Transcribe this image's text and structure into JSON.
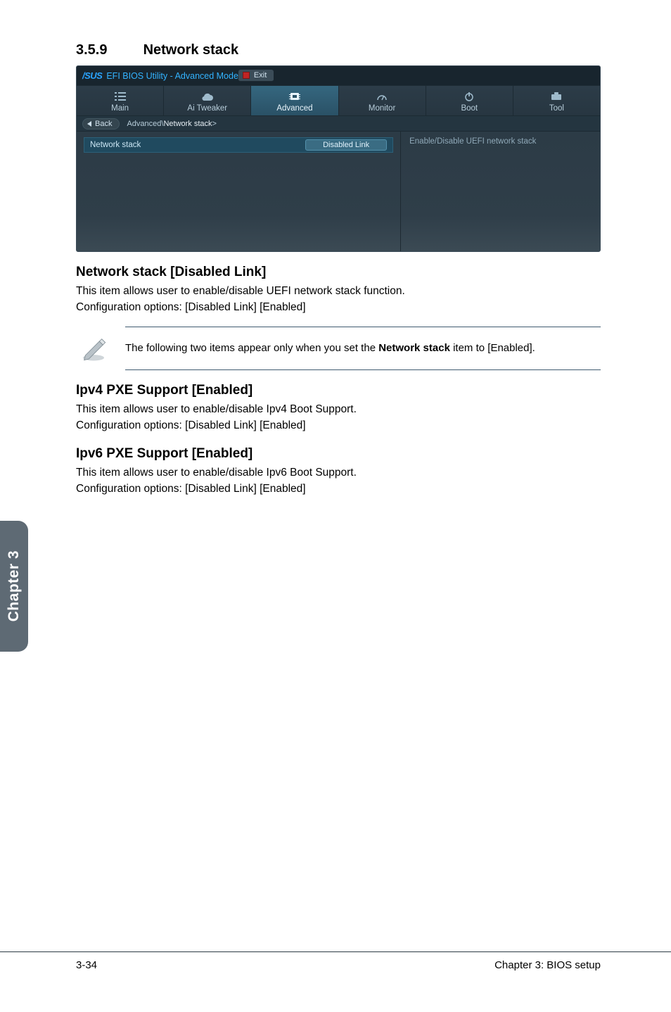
{
  "section": {
    "number": "3.5.9",
    "title": "Network stack"
  },
  "bios": {
    "brand": "/SUS",
    "window_title": "EFI BIOS Utility - Advanced Mode",
    "exit_label": "Exit",
    "tabs": [
      {
        "label": "Main"
      },
      {
        "label": "Ai Tweaker"
      },
      {
        "label": "Advanced"
      },
      {
        "label": "Monitor"
      },
      {
        "label": "Boot"
      },
      {
        "label": "Tool"
      }
    ],
    "back_label": "Back",
    "breadcrumb_prefix": "Advanced\\ ",
    "breadcrumb_item": "Network stack",
    "breadcrumb_suffix": " >",
    "row": {
      "label": "Network stack",
      "value": "Disabled Link"
    },
    "help_text": "Enable/Disable UEFI network stack"
  },
  "sub1": {
    "heading": "Network stack [Disabled Link]",
    "line1": "This item allows user to enable/disable UEFI network stack function.",
    "line2": "Configuration options: [Disabled Link] [Enabled]"
  },
  "note": {
    "prefix": "The following two items appear only when you set the ",
    "bold": "Network stack",
    "suffix": " item to [Enabled]."
  },
  "sub2": {
    "heading": "Ipv4 PXE Support [Enabled]",
    "line1": "This item allows user to enable/disable Ipv4 Boot Support.",
    "line2": "Configuration options: [Disabled Link] [Enabled]"
  },
  "sub3": {
    "heading": "Ipv6 PXE Support [Enabled]",
    "line1": "This item allows user to enable/disable Ipv6 Boot Support.",
    "line2": "Configuration options: [Disabled Link] [Enabled]"
  },
  "side_tab": "Chapter 3",
  "footer": {
    "page": "3-34",
    "chapter": "Chapter 3: BIOS setup"
  }
}
